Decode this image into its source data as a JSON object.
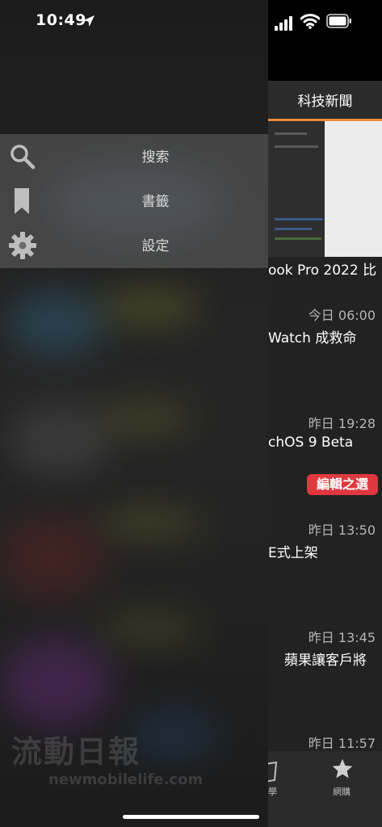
{
  "status_bar": {
    "time": "10:49"
  },
  "menu": {
    "items": [
      {
        "label": "搜索",
        "icon": "search-icon"
      },
      {
        "label": "書籤",
        "icon": "bookmark-icon"
      },
      {
        "label": "設定",
        "icon": "gear-icon"
      }
    ]
  },
  "content": {
    "nav_title": "科技新聞",
    "articles": [
      {
        "headline": "ook Pro 2022 比",
        "time": ""
      },
      {
        "headline": "Watch 成救命",
        "time": "今日 06:00"
      },
      {
        "headline": "chOS 9 Beta",
        "time": "昨日 19:28"
      },
      {
        "headline": "E式上架",
        "time": "昨日 13:50"
      },
      {
        "headline": "蘋果讓客戶將",
        "time": "昨日 13:45"
      },
      {
        "headline": "",
        "time": "昨日 11:57"
      }
    ],
    "editor_pick": "編輯之選",
    "tabs": [
      {
        "label": "學",
        "icon": "learn-icon"
      },
      {
        "label": "網購",
        "icon": "star-icon"
      }
    ]
  },
  "watermark": {
    "title": "流動日報",
    "sub": "newmobilelife.com"
  },
  "colors": {
    "accent": "#e98a3a",
    "pick_badge": "#e0383e"
  }
}
